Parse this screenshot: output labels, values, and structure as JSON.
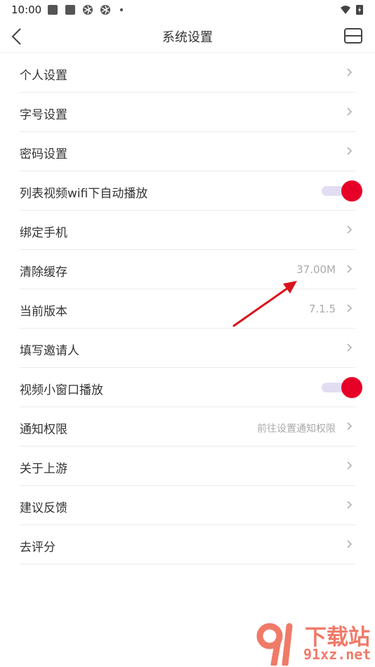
{
  "status_bar": {
    "time": "10:00"
  },
  "header": {
    "title": "系统设置"
  },
  "rows": [
    {
      "label": "个人设置",
      "value": ""
    },
    {
      "label": "字号设置",
      "value": ""
    },
    {
      "label": "密码设置",
      "value": ""
    },
    {
      "label": "列表视频wifi下自动播放",
      "toggle_on": true
    },
    {
      "label": "绑定手机",
      "value": ""
    },
    {
      "label": "清除缓存",
      "value": "37.00M"
    },
    {
      "label": "当前版本",
      "value": "7.1.5"
    },
    {
      "label": "填写邀请人",
      "value": ""
    },
    {
      "label": "视频小窗口播放",
      "toggle_on": true
    },
    {
      "label": "通知权限",
      "value": "前往设置通知权限"
    },
    {
      "label": "关于上游",
      "value": ""
    },
    {
      "label": "建议反馈",
      "value": ""
    },
    {
      "label": "去评分",
      "value": ""
    }
  ],
  "colors": {
    "accent": "#e60028",
    "toggle_track": "#e3ddf3",
    "watermark": "#f07a68"
  },
  "watermark": {
    "brand": "下载站",
    "url": "91xz.net"
  }
}
